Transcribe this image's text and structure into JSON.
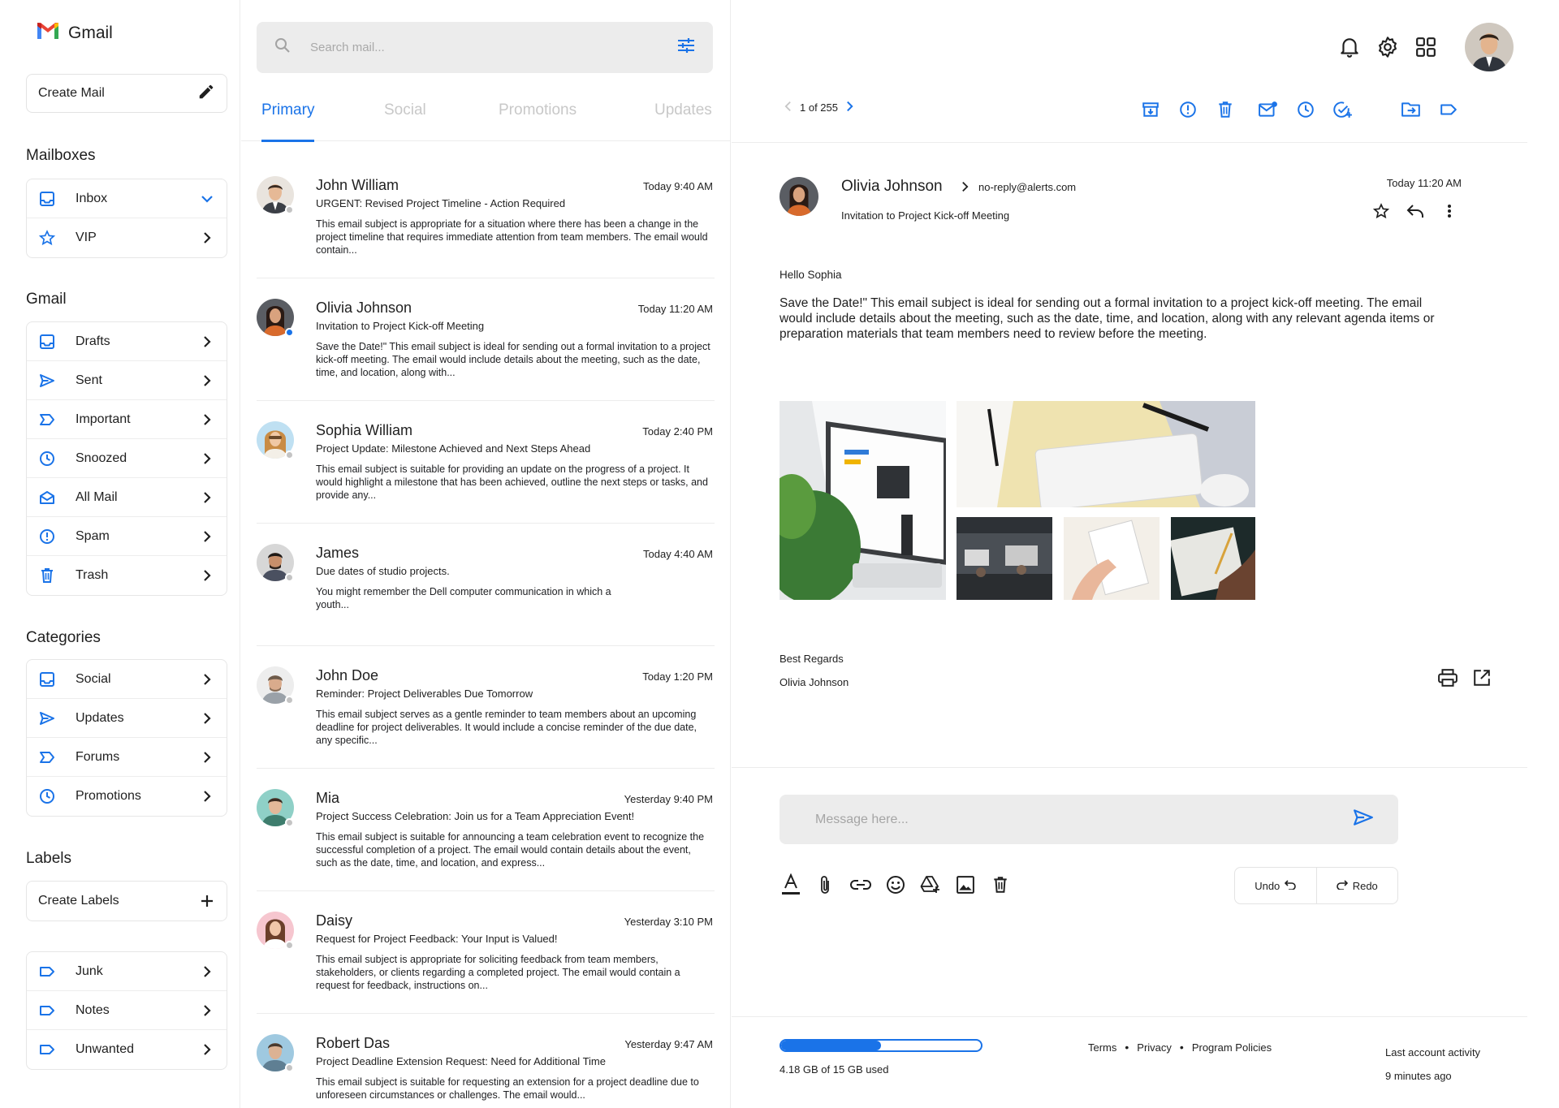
{
  "brand": {
    "name": "Gmail"
  },
  "sidebar": {
    "create_label": "Create Mail",
    "sections": {
      "mailboxes": "Mailboxes",
      "gmail": "Gmail",
      "categories": "Categories",
      "labels": "Labels"
    },
    "mailboxes": [
      {
        "label": "Inbox",
        "icon": "inbox-icon"
      },
      {
        "label": "VIP",
        "icon": "star-icon"
      }
    ],
    "gmail": [
      {
        "label": "Drafts",
        "icon": "drafts-icon"
      },
      {
        "label": "Sent",
        "icon": "send-icon"
      },
      {
        "label": "Important",
        "icon": "important-icon"
      },
      {
        "label": "Snoozed",
        "icon": "clock-icon"
      },
      {
        "label": "All Mail",
        "icon": "all-mail-icon"
      },
      {
        "label": "Spam",
        "icon": "spam-icon"
      },
      {
        "label": "Trash",
        "icon": "trash-icon"
      }
    ],
    "categories": [
      {
        "label": "Social",
        "icon": "inbox-icon"
      },
      {
        "label": "Updates",
        "icon": "send-icon"
      },
      {
        "label": "Forums",
        "icon": "important-icon"
      },
      {
        "label": "Promotions",
        "icon": "clock-icon"
      }
    ],
    "create_labels": "Create Labels",
    "labels": [
      {
        "label": "Junk",
        "icon": "label-icon"
      },
      {
        "label": "Notes",
        "icon": "label-icon"
      },
      {
        "label": "Unwanted",
        "icon": "label-icon"
      }
    ]
  },
  "search": {
    "placeholder": "Search mail..."
  },
  "tabs": [
    "Primary",
    "Social",
    "Promotions",
    "Updates"
  ],
  "mails": [
    {
      "name": "John William",
      "time": "Today 9:40 AM",
      "subject": "URGENT: Revised Project Timeline - Action Required",
      "snippet": "This email subject is appropriate for a situation where there has been a change in the project timeline that requires immediate attention from team members. The email would contain...",
      "status": "#c4c4c4"
    },
    {
      "name": "Olivia Johnson",
      "time": "Today 11:20 AM",
      "subject": "Invitation to Project Kick-off Meeting",
      "snippet": "Save the Date!\" This email subject is ideal for sending out a formal invitation to a project kick-off meeting. The email would include details about the meeting, such as the date, time, and location, along with...",
      "status": "#1a73e8"
    },
    {
      "name": "Sophia William",
      "time": "Today 2:40 PM",
      "subject": "Project Update: Milestone Achieved and Next Steps Ahead",
      "snippet": "This email subject is suitable for providing an update on the progress of a project. It would highlight a milestone that has been achieved, outline the next steps or tasks, and provide any...",
      "status": "#c4c4c4"
    },
    {
      "name": "James",
      "time": "Today 4:40 AM",
      "subject": "Due dates of studio projects.",
      "snippet": "You might remember the Dell computer communication in which a youth...",
      "status": "#c4c4c4"
    },
    {
      "name": "John Doe",
      "time": "Today 1:20 PM",
      "subject": "Reminder: Project Deliverables Due Tomorrow",
      "snippet": "This email subject serves as a gentle reminder to team members about an upcoming deadline for project deliverables. It would include a concise reminder of the due date, any specific...",
      "status": "#c4c4c4"
    },
    {
      "name": "Mia",
      "time": "Yesterday 9:40 PM",
      "subject": "Project Success Celebration: Join us for a Team Appreciation Event!",
      "snippet": "This email subject is suitable for announcing a team celebration event to recognize the successful completion of a project. The email would contain details about the event, such as the date, time, and location, and express...",
      "status": "#c4c4c4"
    },
    {
      "name": "Daisy",
      "time": "Yesterday 3:10 PM",
      "subject": "Request for Project Feedback: Your Input is Valued!",
      "snippet": "This email subject is appropriate for soliciting feedback from team members, stakeholders, or clients regarding a completed project. The email would contain a request for feedback, instructions on...",
      "status": "#c4c4c4"
    },
    {
      "name": "Robert Das",
      "time": "Yesterday 9:47 AM",
      "subject": "Project Deadline Extension Request: Need for Additional Time",
      "snippet": "This email subject is suitable for requesting an extension for a project deadline due to unforeseen circumstances or challenges. The email would...",
      "status": "#c4c4c4"
    }
  ],
  "pager": {
    "text": "1 of 255"
  },
  "toolbar_icons": [
    "archive-icon",
    "report-spam-icon",
    "delete-icon",
    "mark-unread-icon",
    "snooze-icon",
    "add-task-icon",
    "move-to-icon",
    "label-icon"
  ],
  "message": {
    "from": "Olivia Johnson",
    "address": "no-reply@alerts.com",
    "subject": "Invitation to Project Kick-off Meeting",
    "date": "Today 11:20 AM",
    "greeting": "Hello Sophia",
    "body": "Save the Date!\" This email subject is ideal for sending out a formal invitation to a project kick-off meeting. The email would include details about the meeting, such as the date, time, and location, along with any relevant agenda items or preparation materials that team members need to review before the meeting.",
    "signoff": "Best Regards",
    "signature": "Olivia Johnson"
  },
  "compose": {
    "placeholder": "Message here...",
    "undo": "Undo",
    "redo": "Redo"
  },
  "storage": {
    "text": "4.18 GB of 15 GB used",
    "used_fraction": 0.5
  },
  "footer": {
    "terms": "Terms",
    "privacy": "Privacy",
    "policies": "Program Policies",
    "bullet": "•"
  },
  "activity": {
    "title": "Last account activity",
    "value": "9 minutes ago"
  },
  "colors": {
    "accent": "#1a73e8",
    "surface": "#ececec"
  }
}
